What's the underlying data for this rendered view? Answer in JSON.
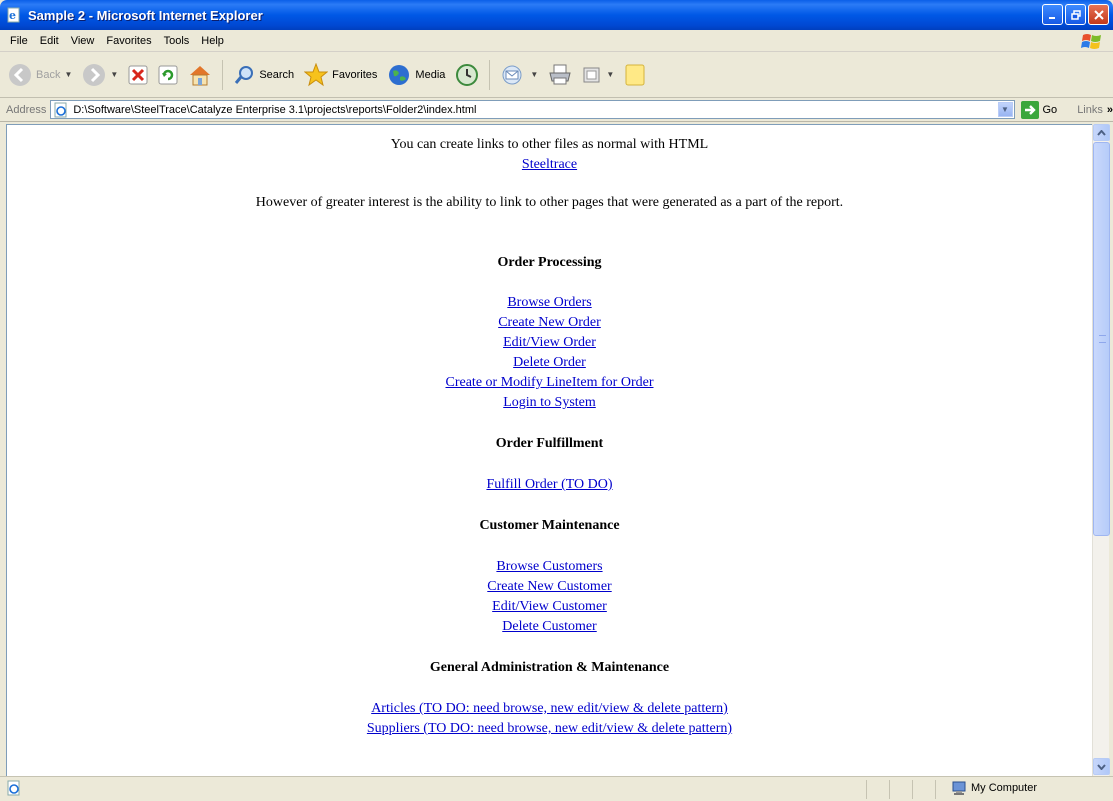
{
  "window": {
    "title": "Sample 2 - Microsoft Internet Explorer"
  },
  "menu": {
    "items": [
      "File",
      "Edit",
      "View",
      "Favorites",
      "Tools",
      "Help"
    ]
  },
  "toolbar": {
    "back_label": "Back",
    "search_label": "Search",
    "favorites_label": "Favorites",
    "media_label": "Media"
  },
  "address": {
    "label": "Address",
    "url": "D:\\Software\\SteelTrace\\Catalyze Enterprise 3.1\\projects\\reports\\Folder2\\index.html",
    "go_label": "Go",
    "links_label": "Links"
  },
  "page": {
    "intro": "You can create links to other files as normal with HTML",
    "intro_link": "Steeltrace",
    "interest_text": "However of greater interest is the ability to link to other pages that were generated as a part of the report.",
    "sections": [
      {
        "heading": "Order Processing",
        "links": [
          "Browse Orders",
          "Create New Order",
          "Edit/View Order",
          "Delete Order",
          "Create or Modify LineItem for Order",
          "Login to System"
        ]
      },
      {
        "heading": "Order Fulfillment",
        "links": [
          "Fulfill Order (TO DO)"
        ]
      },
      {
        "heading": "Customer Maintenance",
        "links": [
          "Browse Customers",
          "Create New Customer",
          "Edit/View Customer",
          "Delete Customer"
        ]
      },
      {
        "heading": "General Administration & Maintenance",
        "links": [
          "Articles (TO DO: need browse, new edit/view & delete pattern)",
          "Suppliers (TO DO: need browse, new edit/view & delete pattern)"
        ]
      }
    ]
  },
  "status": {
    "zone_label": "My Computer"
  },
  "colors": {
    "link": "#0000CC",
    "titlebar": "#0058E6",
    "chrome": "#ECE9D8"
  }
}
